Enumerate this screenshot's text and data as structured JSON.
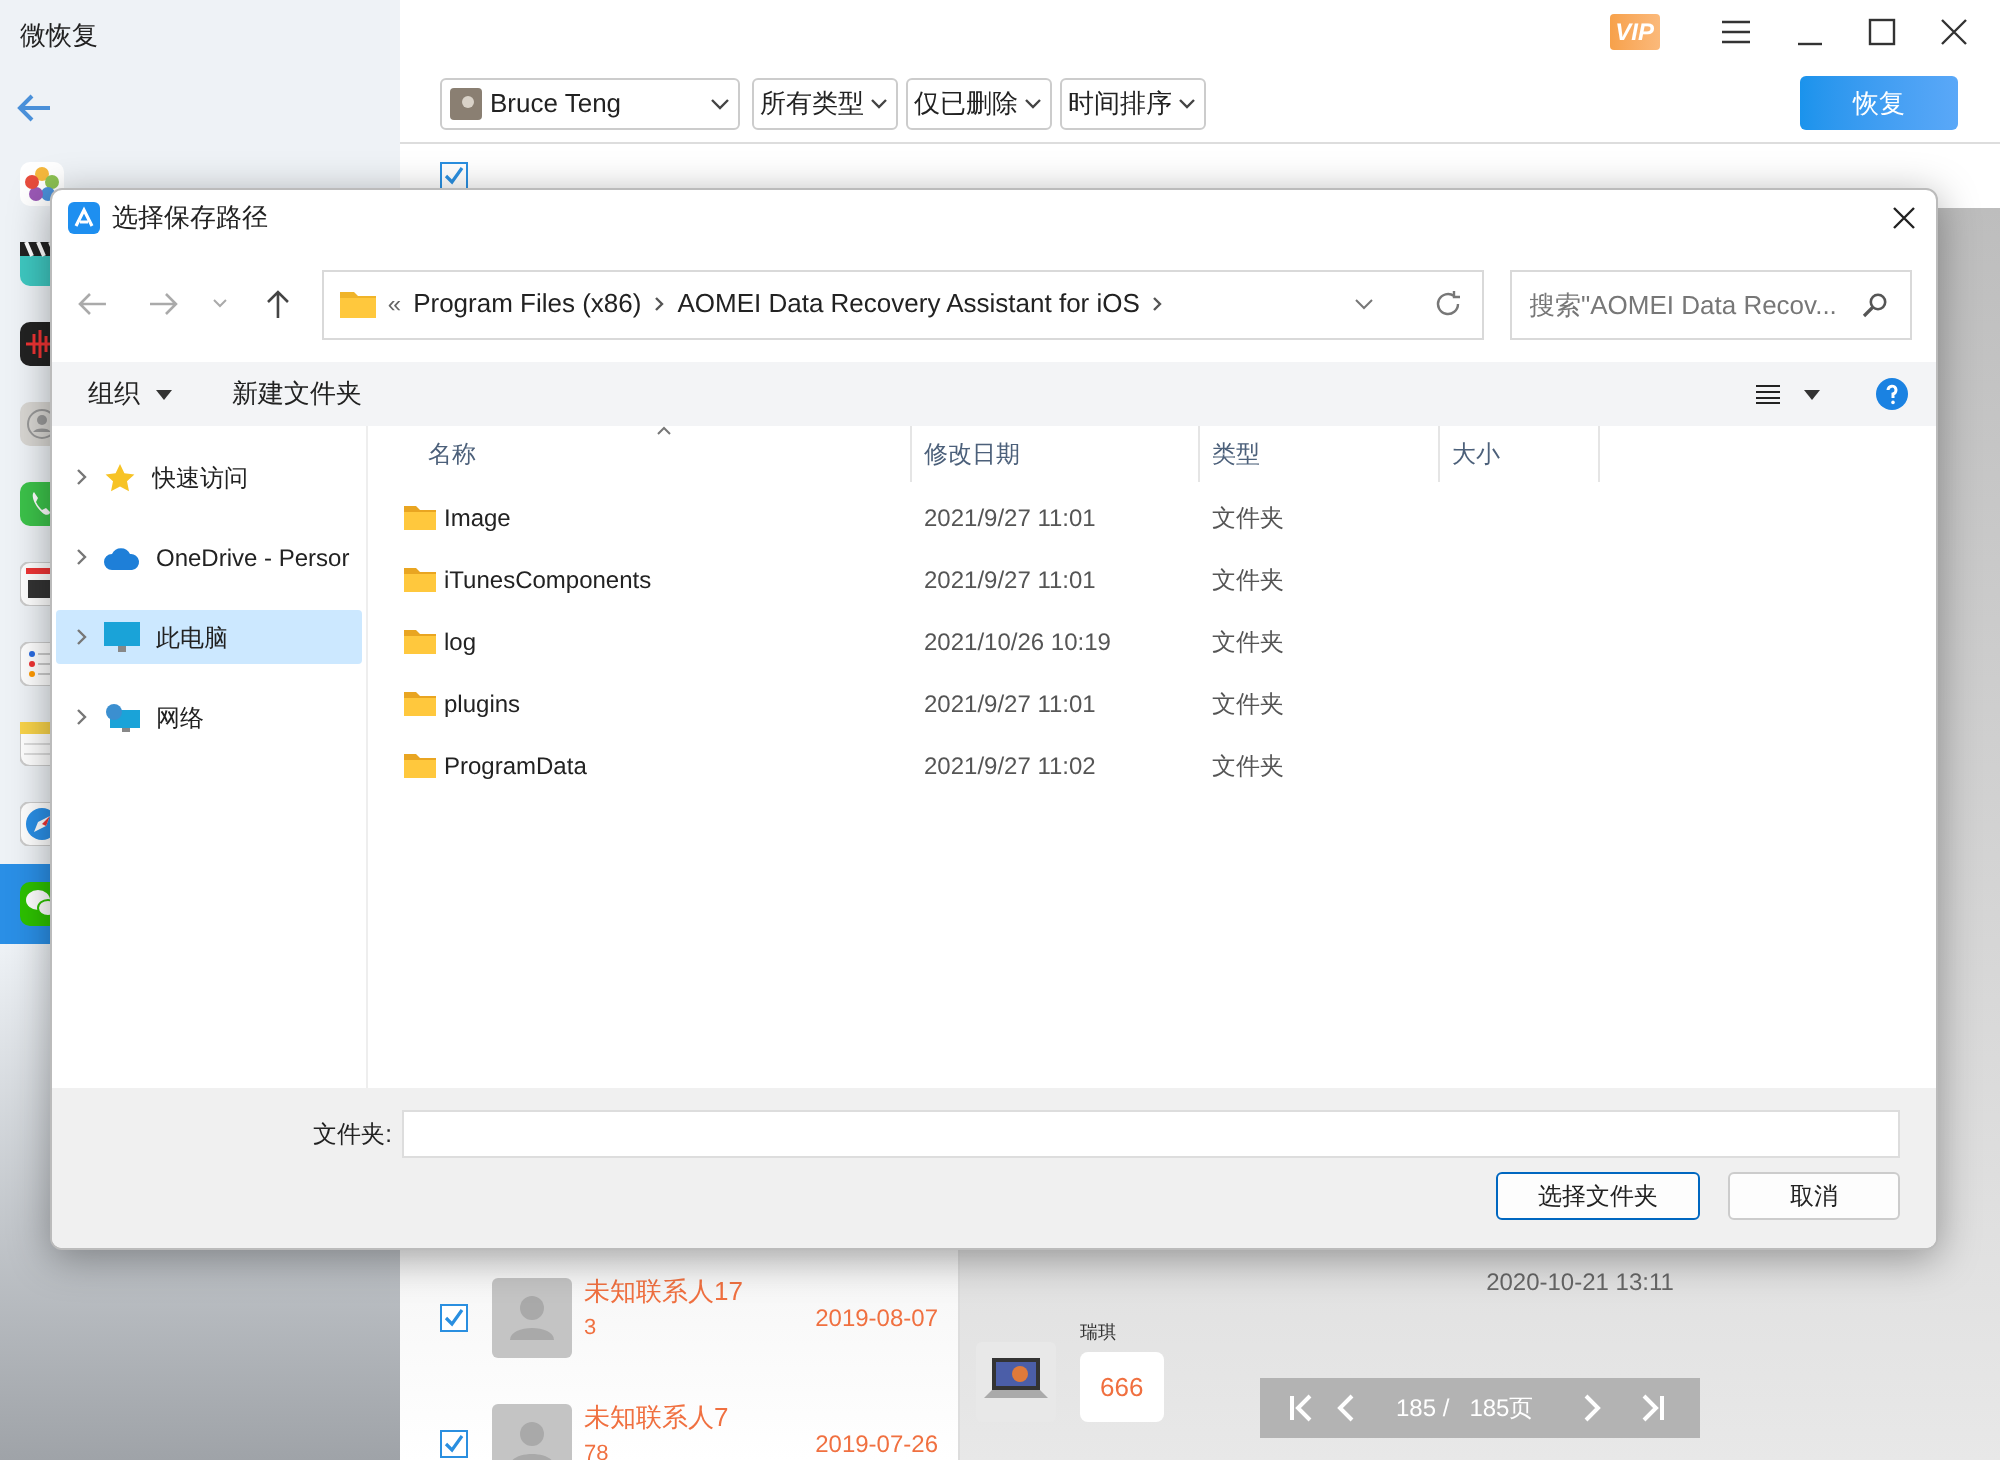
{
  "app": {
    "title": "微恢复",
    "sidebar": [
      {
        "kind": "photos",
        "selected": false
      },
      {
        "kind": "video",
        "selected": false
      },
      {
        "kind": "voice",
        "selected": false
      },
      {
        "kind": "contacts",
        "selected": false
      },
      {
        "kind": "phone",
        "selected": false
      },
      {
        "kind": "calendar",
        "selected": false
      },
      {
        "kind": "reminders",
        "selected": false
      },
      {
        "kind": "notes",
        "selected": false
      },
      {
        "kind": "safari",
        "selected": false
      },
      {
        "kind": "wechat",
        "selected": true
      }
    ],
    "vip": "VIP",
    "toolbar": {
      "account": "Bruce Teng",
      "filters": [
        "所有类型",
        "仅已删除",
        "时间排序"
      ],
      "recover_button": "恢复"
    },
    "select_all": {
      "checked": true
    },
    "contacts": [
      {
        "name": "未知联系人17",
        "count": "3",
        "date": "2019-08-07",
        "checked": true
      },
      {
        "name": "未知联系人7",
        "count": "78",
        "date": "2019-07-26",
        "checked": true
      }
    ],
    "chat": {
      "timestamp": "2020-10-21 13:11",
      "messages": [
        {
          "sender": "瑞琪",
          "text": "666"
        }
      ]
    },
    "pager": {
      "current": "185 /",
      "total": "185页"
    }
  },
  "dialog": {
    "title": "选择保存路径",
    "overflow_mark": "«",
    "breadcrumb": [
      "Program Files (x86)",
      "AOMEI Data Recovery Assistant for iOS"
    ],
    "search": {
      "placeholder": "搜索\"AOMEI Data Recov..."
    },
    "commands": [
      "组织",
      "新建文件夹"
    ],
    "nav": [
      {
        "kind": "star",
        "label": "快速访问",
        "selected": false
      },
      {
        "kind": "cloud",
        "label": "OneDrive - Persor",
        "selected": false
      },
      {
        "kind": "computer",
        "label": "此电脑",
        "selected": true
      },
      {
        "kind": "network",
        "label": "网络",
        "selected": false
      }
    ],
    "columns": [
      "名称",
      "修改日期",
      "类型",
      "大小"
    ],
    "files": [
      {
        "name": "Image",
        "modified": "2021/9/27 11:01",
        "type": "文件夹"
      },
      {
        "name": "iTunesComponents",
        "modified": "2021/9/27 11:01",
        "type": "文件夹"
      },
      {
        "name": "log",
        "modified": "2021/10/26 10:19",
        "type": "文件夹"
      },
      {
        "name": "plugins",
        "modified": "2021/9/27 11:01",
        "type": "文件夹"
      },
      {
        "name": "ProgramData",
        "modified": "2021/9/27 11:02",
        "type": "文件夹"
      }
    ],
    "folder_label": "文件夹:",
    "buttons": [
      "选择文件夹",
      "取消"
    ]
  }
}
